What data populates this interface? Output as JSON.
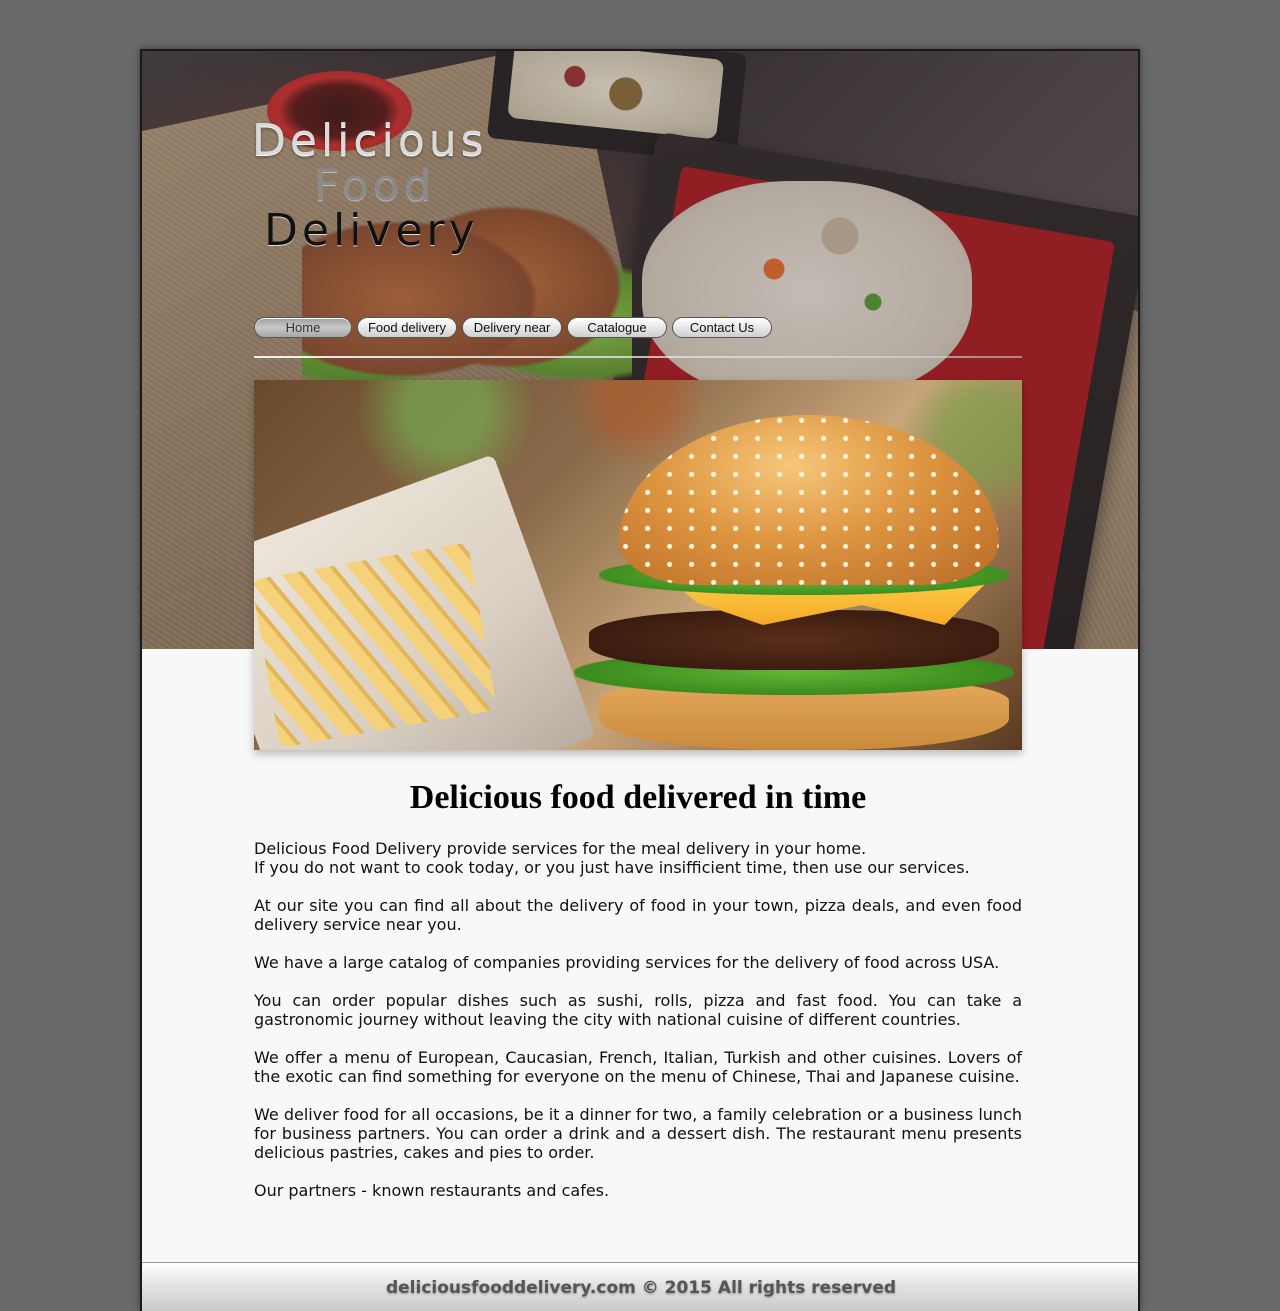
{
  "logo": {
    "line1": "Delicious",
    "line2": "Food",
    "line3": "Delivery"
  },
  "nav": {
    "items": [
      {
        "label": "Home",
        "active": true
      },
      {
        "label": "Food delivery",
        "active": false
      },
      {
        "label": "Delivery near",
        "active": false
      },
      {
        "label": "Catalogue",
        "active": false
      },
      {
        "label": "Contact Us",
        "active": false
      }
    ]
  },
  "main": {
    "heading": "Delicious food delivered in time",
    "paragraphs": [
      {
        "line1": "Delicious Food Delivery provide services for the meal delivery in your home.",
        "line2": "If you do not want to cook today, or you just have insifficient time, then use our services."
      },
      {
        "text": "At our site you can find all about the delivery of food in your town, pizza deals, and even food delivery service near you."
      },
      {
        "text": "We have a large catalog of companies providing services for the delivery of food across USA."
      },
      {
        "text": "You can order popular dishes such as sushi, rolls, pizza and fast food. You can take a gastronomic journey without leaving the city with national cuisine of different countries."
      },
      {
        "text": "We offer a menu of European, Caucasian, French, Italian, Turkish and other cuisines. Lovers of the exotic can find something for everyone on the menu of Chinese, Thai and Japanese cuisine."
      },
      {
        "text": "We deliver food for all occasions, be it a dinner for two, a family celebration or a business lunch for business partners. You can order a drink and a dessert dish. The restaurant menu presents delicious pastries, cakes and pies to order."
      },
      {
        "text": "Our partners - known restaurants and cafes."
      }
    ]
  },
  "footer": {
    "text": "deliciousfooddelivery.com © 2015 All rights reserved"
  }
}
